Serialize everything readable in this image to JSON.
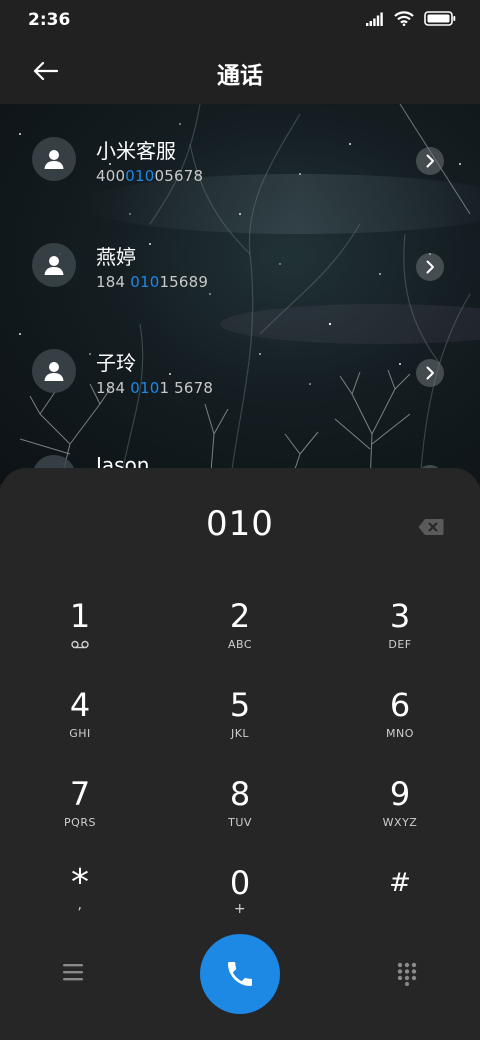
{
  "status_bar": {
    "time": "2:36"
  },
  "header": {
    "title": "通话"
  },
  "contacts": [
    {
      "name": "小米客服",
      "number_pre": "400",
      "number_match": "010",
      "number_post": "05678"
    },
    {
      "name": "燕婷",
      "number_pre": "184 ",
      "number_match": "010",
      "number_post": "15689"
    },
    {
      "name": "子玲",
      "number_pre": "184 ",
      "number_match": "010",
      "number_post": "1 5678"
    },
    {
      "name": "Jason",
      "number_pre": "",
      "number_match": "",
      "number_post": ""
    }
  ],
  "dialpad": {
    "display": "010",
    "keys": [
      {
        "digit": "1",
        "sub": ""
      },
      {
        "digit": "2",
        "sub": "ABC"
      },
      {
        "digit": "3",
        "sub": "DEF"
      },
      {
        "digit": "4",
        "sub": "GHI"
      },
      {
        "digit": "5",
        "sub": "JKL"
      },
      {
        "digit": "6",
        "sub": "MNO"
      },
      {
        "digit": "7",
        "sub": "PQRS"
      },
      {
        "digit": "8",
        "sub": "TUV"
      },
      {
        "digit": "9",
        "sub": "WXYZ"
      },
      {
        "digit": "*",
        "sub": ","
      },
      {
        "digit": "0",
        "sub": "+"
      },
      {
        "digit": "#",
        "sub": ""
      }
    ]
  },
  "colors": {
    "accent": "#1e88e5",
    "background": "#262626"
  }
}
